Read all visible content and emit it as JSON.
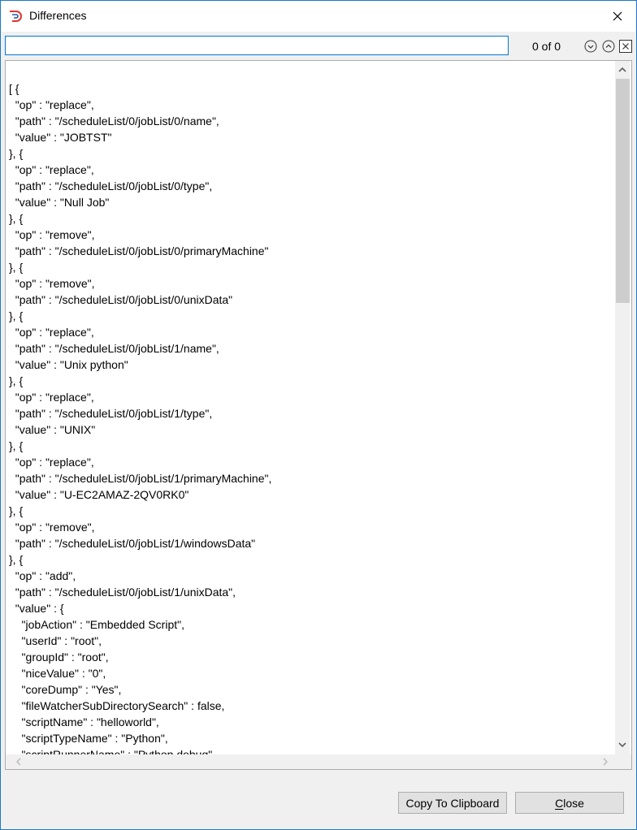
{
  "window": {
    "title": "Differences",
    "app_icon": "app-logo-icon",
    "close_icon": "close-icon"
  },
  "search": {
    "value": "",
    "placeholder": "",
    "match_count": "0 of 0",
    "next_icon": "chevron-down-circle-icon",
    "prev_icon": "chevron-up-circle-icon",
    "close_icon": "close-box-icon"
  },
  "content": {
    "lines": [
      "[ {",
      "  \"op\" : \"replace\",",
      "  \"path\" : \"/scheduleList/0/jobList/0/name\",",
      "  \"value\" : \"JOBTST\"",
      "}, {",
      "  \"op\" : \"replace\",",
      "  \"path\" : \"/scheduleList/0/jobList/0/type\",",
      "  \"value\" : \"Null Job\"",
      "}, {",
      "  \"op\" : \"remove\",",
      "  \"path\" : \"/scheduleList/0/jobList/0/primaryMachine\"",
      "}, {",
      "  \"op\" : \"remove\",",
      "  \"path\" : \"/scheduleList/0/jobList/0/unixData\"",
      "}, {",
      "  \"op\" : \"replace\",",
      "  \"path\" : \"/scheduleList/0/jobList/1/name\",",
      "  \"value\" : \"Unix python\"",
      "}, {",
      "  \"op\" : \"replace\",",
      "  \"path\" : \"/scheduleList/0/jobList/1/type\",",
      "  \"value\" : \"UNIX\"",
      "}, {",
      "  \"op\" : \"replace\",",
      "  \"path\" : \"/scheduleList/0/jobList/1/primaryMachine\",",
      "  \"value\" : \"U-EC2AMAZ-2QV0RK0\"",
      "}, {",
      "  \"op\" : \"remove\",",
      "  \"path\" : \"/scheduleList/0/jobList/1/windowsData\"",
      "}, {",
      "  \"op\" : \"add\",",
      "  \"path\" : \"/scheduleList/0/jobList/1/unixData\",",
      "  \"value\" : {",
      "    \"jobAction\" : \"Embedded Script\",",
      "    \"userId\" : \"root\",",
      "    \"groupId\" : \"root\",",
      "    \"niceValue\" : \"0\",",
      "    \"coreDump\" : \"Yes\",",
      "    \"fileWatcherSubDirectorySearch\" : false,",
      "    \"scriptName\" : \"helloworld\",",
      "    \"scriptTypeName\" : \"Python\",",
      "    \"scriptRunnerName\" : \"Python debug\","
    ]
  },
  "buttons": {
    "copy": "Copy To Clipboard",
    "close": "Close"
  },
  "colors": {
    "accent": "#0078d7",
    "window_border": "#1979ca",
    "logo_red": "#e0352b",
    "logo_blue": "#1f5fa8"
  }
}
